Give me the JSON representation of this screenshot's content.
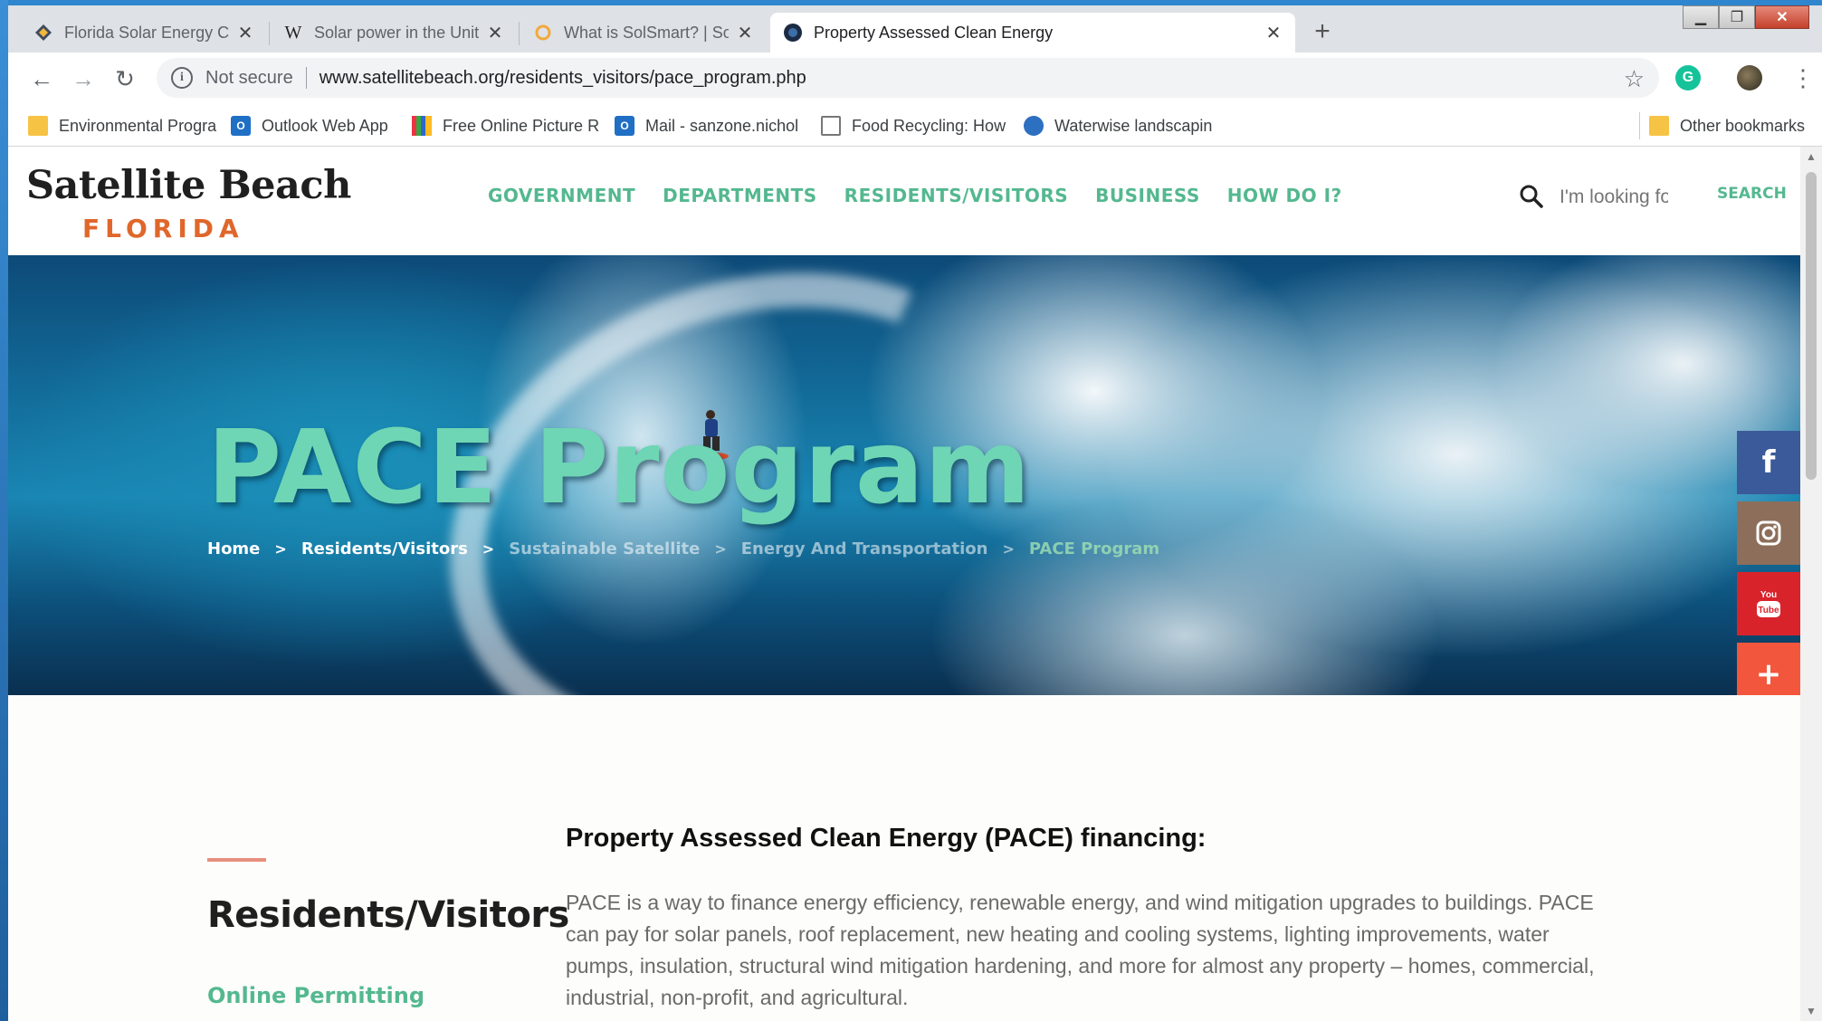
{
  "tabs": [
    {
      "label": "Florida Solar Energy Center",
      "icon": "fsec-diamond-icon",
      "active": false
    },
    {
      "label": "Solar power in the United States",
      "icon": "wikipedia-w-icon",
      "active": false
    },
    {
      "label": "What is SolSmart? | SolSmart",
      "icon": "solsmart-sun-icon",
      "active": false
    },
    {
      "label": "Property Assessed Clean Energy",
      "icon": "site-globe-icon",
      "active": true
    }
  ],
  "toolbar": {
    "security_label": "Not secure",
    "url": "www.satellitebeach.org/residents_visitors/pace_program.php"
  },
  "bookmarks": [
    {
      "label": "Environmental Progra",
      "icon": "folder-icon"
    },
    {
      "label": "Outlook Web App",
      "icon": "outlook-icon"
    },
    {
      "label": "Free Online Picture R",
      "icon": "picture-grid-icon"
    },
    {
      "label": "Mail - sanzone.nichol",
      "icon": "outlook-icon"
    },
    {
      "label": "Food Recycling: How",
      "icon": "document-icon"
    },
    {
      "label": "Waterwise landscapin",
      "icon": "globe-icon"
    }
  ],
  "other_bookmarks": "Other bookmarks",
  "site": {
    "logo_top": "Satellite Beach",
    "logo_bottom": "FLORIDA",
    "nav": [
      "GOVERNMENT",
      "DEPARTMENTS",
      "RESIDENTS/VISITORS",
      "BUSINESS",
      "HOW DO I?"
    ],
    "search_placeholder": "I'm looking for...",
    "search_button": "SEARCH"
  },
  "hero": {
    "title_part1": "PACE",
    "title_part2": "Program",
    "breadcrumb": [
      "Home",
      "Residents/Visitors",
      "Sustainable Satellite",
      "Energy And Transportation",
      "PACE Program"
    ],
    "separator": ">"
  },
  "social": [
    {
      "name": "facebook",
      "glyph": "f",
      "color": "#3b5a9a"
    },
    {
      "name": "instagram",
      "glyph": "◙",
      "color": "#8d6e5a"
    },
    {
      "name": "youtube",
      "glyph": "You Tube",
      "color": "#d9232b"
    },
    {
      "name": "more",
      "glyph": "+",
      "color": "#f2563c"
    }
  ],
  "sidebar": {
    "title": "Residents/Visitors",
    "link": "Online Permitting"
  },
  "main": {
    "heading": "Property Assessed Clean Energy (PACE) financing:",
    "paragraph": "PACE is a way to finance energy efficiency, renewable energy, and wind mitigation upgrades to buildings. PACE can pay for solar panels, roof replacement, new heating and cooling systems, lighting improvements, water pumps, insulation, structural wind mitigation hardening, and more for almost any property – homes, commercial, industrial, non-profit, and agricultural."
  },
  "colors": {
    "accent_green": "#54b88f",
    "logo_orange": "#e0672b",
    "title_mint": "#6ed6b4"
  }
}
